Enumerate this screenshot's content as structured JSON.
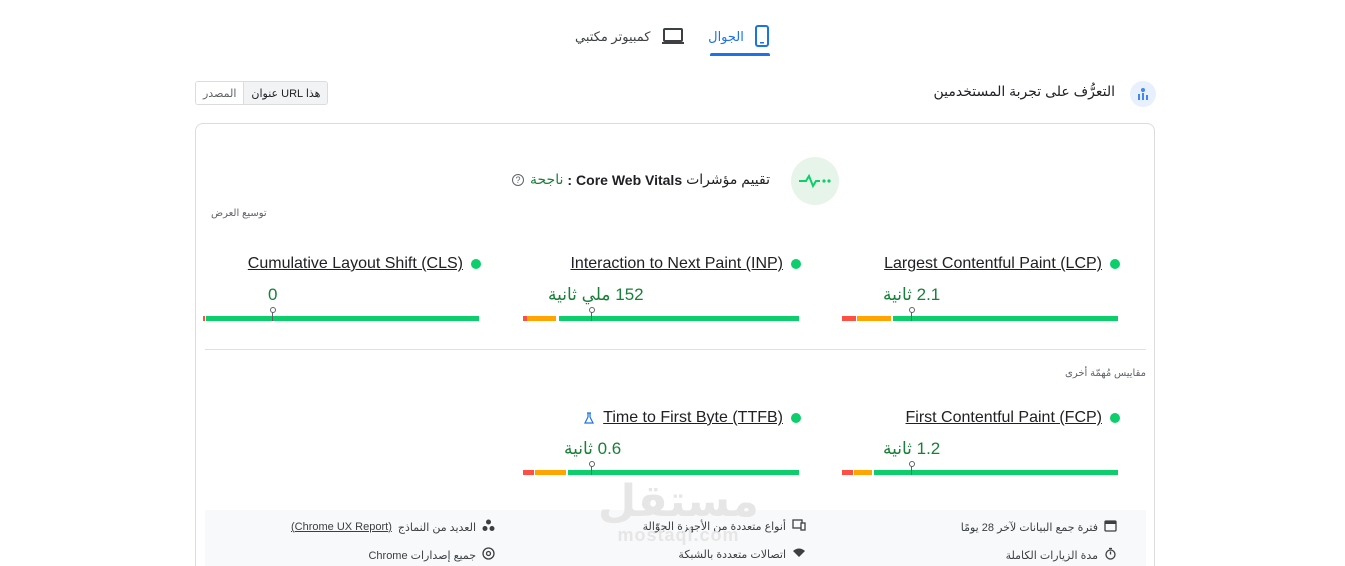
{
  "tabs": {
    "mobile": "الجوال",
    "desktop": "كمبيوتر مكتبي"
  },
  "section": {
    "title": "التعرُّف على تجربة المستخدمين",
    "url_toggle": {
      "this_url": "عنوان URL هذا",
      "origin": "المصدر"
    }
  },
  "cwv": {
    "prefix": "تقييم مؤشرات",
    "name": "Core Web Vitals",
    "colon": ":",
    "status": "ناجحة",
    "expand_label": "توسيع العرض"
  },
  "metrics": {
    "lcp": {
      "name": "Largest Contentful Paint (LCP)",
      "value": "2.1 ثانية",
      "status_color": "#0cce6b"
    },
    "inp": {
      "name": "Interaction to Next Paint (INP)",
      "value": "152 ملي ثانية",
      "status_color": "#0cce6b"
    },
    "cls": {
      "name": "Cumulative Layout Shift (CLS)",
      "value": "0",
      "status_color": "#0cce6b"
    },
    "fcp": {
      "name": "First Contentful Paint (FCP)",
      "value": "1.2 ثانية",
      "status_color": "#0cce6b"
    },
    "ttfb": {
      "name": "Time to First Byte (TTFB)",
      "value": "0.6 ثانية",
      "status_color": "#0cce6b"
    }
  },
  "other_metrics_label": "مقاييس مُهمّة أخرى",
  "info": {
    "collection_period": "فترة جمع البيانات لآخر 28 يومًا",
    "devices": "أنواع متعددة من الأجهزة الجوّالة",
    "samples_prefix": "العديد من النماذج",
    "samples_link": "(Chrome UX Report)",
    "full_visits": "مدة الزيارات الكاملة",
    "connections": "اتصالات متعددة بالشبكة",
    "chrome_versions": "جميع إصدارات Chrome"
  },
  "watermark": {
    "arabic": "مستقل",
    "latin": "mostaql.com"
  },
  "colors": {
    "accent": "#1a73e8",
    "pass": "#188038",
    "good": "#0cce6b",
    "needs_improvement": "#ffa400",
    "poor": "#ff4e42"
  }
}
